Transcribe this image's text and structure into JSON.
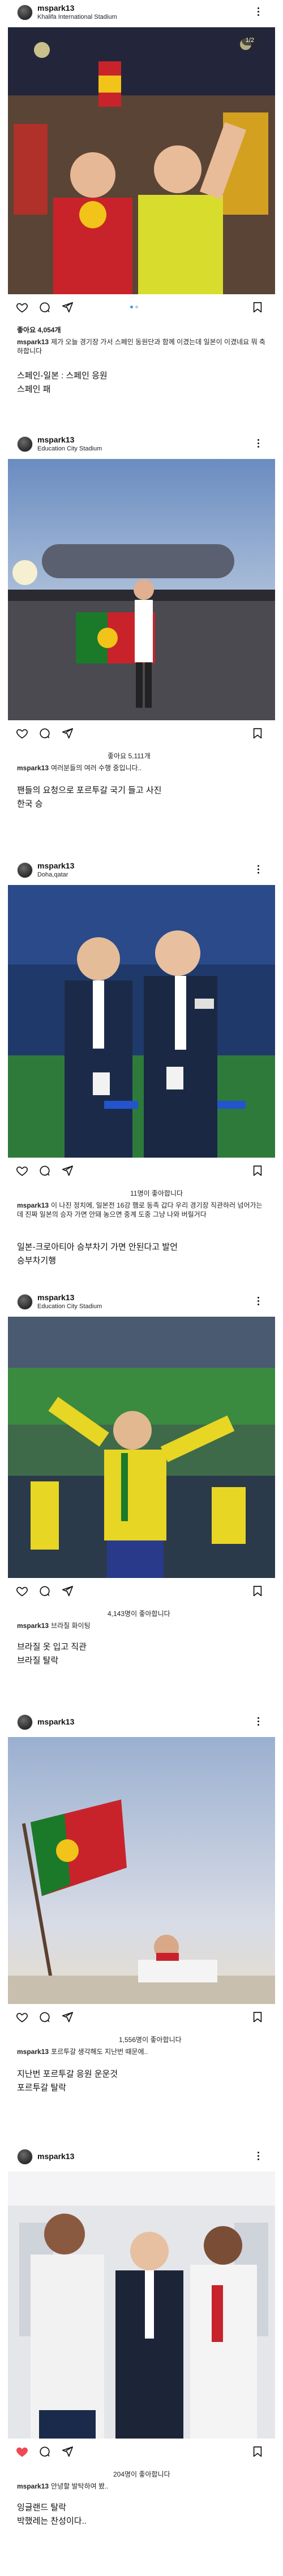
{
  "posts": [
    {
      "username": "mspark13",
      "location": "Khalifa International Stadium",
      "carousel_counter": "1/2",
      "likes": "좋아요 4,054개",
      "caption": "제가 오늘 경기장 가서 스페인 동원단과 함께 이겼는데 일본이 이겼네요 뭐 축하합니다",
      "comment_lines": [
        "스페인-일본 : 스페인 응원",
        "스페인 패"
      ]
    },
    {
      "username": "mspark13",
      "location": "Education City Stadium",
      "likes": "좋아요 5,111개",
      "caption": "여러분들의 여러 수행 중입니다..",
      "comment_lines": [
        "팬들의 요청으로 포르투갈 국기 들고 사진",
        "한국 승"
      ]
    },
    {
      "username": "mspark13",
      "location": "Doha,qatar",
      "likes": "11명이 좋아합니다",
      "caption": "이 나진 정치에, 일본전 16강 햄로 동족 갑다 우리 경기장 직관하러 넘어가는데 진짜 일본의 승자 가면 안돼 농으면 중계 도중 그냥 나와 버릴거다",
      "comment_lines": [
        "일본-크로아티아 승부차기 가면 안된다고 발언",
        "승부차기행"
      ]
    },
    {
      "username": "mspark13",
      "location": "Education City Stadium",
      "likes": "4,143명이 좋아합니다",
      "caption": "브라질 화이팅",
      "comment_lines": [
        "브라질 옷 입고 직관",
        "브라질 탈락"
      ]
    },
    {
      "username": "mspark13",
      "location": "",
      "likes": "1,556명이 좋아합니다",
      "caption": "포르투갈 생각해도 지난번 때문에..",
      "comment_lines": [
        "지난번 포르투갈 응원 운운것",
        "포르투갈 탈락"
      ]
    },
    {
      "username": "mspark13",
      "location": "",
      "likes": "204명이 좋아합니다",
      "caption": "안녕할 발탁하여 봤..",
      "comment_lines": [
        "잉글랜드 탈락",
        "박했레는 찬성이다.."
      ]
    }
  ],
  "icons": {
    "like": "heart-icon",
    "comment": "comment-icon",
    "share": "paper-plane-icon",
    "save": "bookmark-icon",
    "more": "more-options-icon"
  },
  "colors": {
    "liked_heart": "#ed4956",
    "carousel_active_dot": "#3897f0"
  }
}
